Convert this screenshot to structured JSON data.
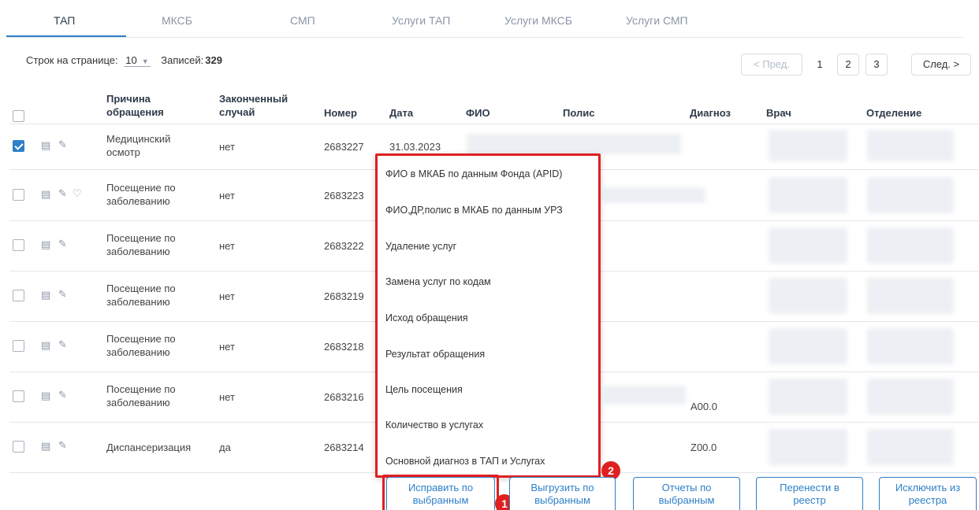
{
  "tabs": [
    "ТАП",
    "МКСБ",
    "СМП",
    "Услуги ТАП",
    "Услуги МКСБ",
    "Услуги СМП"
  ],
  "pagination": {
    "rows_label": "Строк на странице:",
    "rows_value": "10",
    "records_label": "Записей:",
    "records_value": "329",
    "prev": "< Пред.",
    "pages": [
      "1",
      "2",
      "3"
    ],
    "next": "След. >",
    "current_page": "1"
  },
  "table": {
    "headers": {
      "reason_1": "Причина",
      "reason_2": "обращения",
      "finished_1": "Законченный",
      "finished_2": "случай",
      "number": "Номер",
      "date": "Дата",
      "fio": "ФИО",
      "policy": "Полис",
      "diagnosis": "Диагноз",
      "doctor": "Врач",
      "department": "Отделение"
    },
    "rows": [
      {
        "reason_1": "Медицинский",
        "reason_2": "осмотр",
        "finished": "нет",
        "number": "2683227",
        "date": "31.03.2023",
        "diagnosis": "",
        "checked": true
      },
      {
        "reason_1": "Посещение по",
        "reason_2": "заболеванию",
        "finished": "нет",
        "number": "2683223",
        "date": "",
        "diagnosis": "",
        "checked": false
      },
      {
        "reason_1": "Посещение по",
        "reason_2": "заболеванию",
        "finished": "нет",
        "number": "2683222",
        "date": "",
        "diagnosis": "",
        "checked": false
      },
      {
        "reason_1": "Посещение по",
        "reason_2": "заболеванию",
        "finished": "нет",
        "number": "2683219",
        "date": "",
        "diagnosis": "",
        "checked": false
      },
      {
        "reason_1": "Посещение по",
        "reason_2": "заболеванию",
        "finished": "нет",
        "number": "2683218",
        "date": "",
        "diagnosis": "",
        "checked": false
      },
      {
        "reason_1": "Посещение по",
        "reason_2": "заболеванию",
        "finished": "нет",
        "number": "2683216",
        "date": "",
        "diagnosis": "A00.0",
        "checked": false
      },
      {
        "reason_1": "Диспансеризация",
        "reason_2": "",
        "finished": "да",
        "number": "2683214",
        "date": "",
        "diagnosis": "Z00.0",
        "checked": false
      }
    ]
  },
  "menu": {
    "items": [
      "ФИО в МКАБ по данным Фонда (APID)",
      "ФИО,ДР,полис в МКАБ по данным УРЗ",
      "Удаление услуг",
      "Замена услуг по кодам",
      "Исход обращения",
      "Результат обращения",
      "Цель посещения",
      "Количество в услугах",
      "Основной диагноз в ТАП и Услугах"
    ]
  },
  "buttons": {
    "fix": [
      "Исправить по",
      "выбранным"
    ],
    "export": [
      "Выгрузить по",
      "выбранным"
    ],
    "reports": [
      "Отчеты по",
      "выбранным"
    ],
    "move": [
      "Перенести в",
      "реестр"
    ],
    "exclude": [
      "Исключить из",
      "реестра"
    ]
  },
  "annotations": {
    "badge_1": "1",
    "badge_2": "2"
  },
  "colors": {
    "accent": "#2f80c8",
    "highlight": "#e02020",
    "muted": "#8a94a6"
  }
}
